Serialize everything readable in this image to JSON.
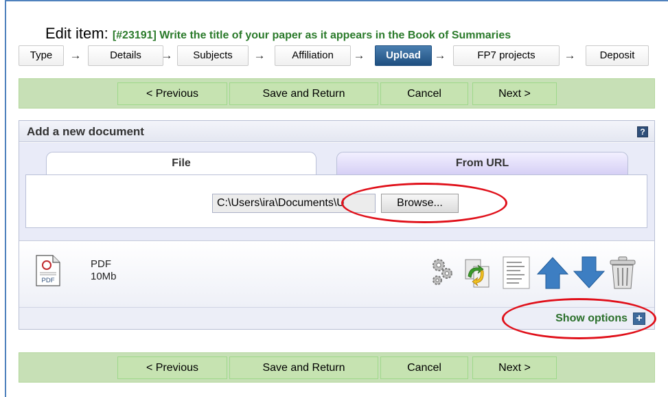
{
  "title": {
    "prefix": "Edit item: ",
    "main": "[#23191] Write the title of your paper as it appears in the Book of Summaries"
  },
  "steps": [
    "Type",
    "Details",
    "Subjects",
    "Affiliation",
    "Upload",
    "FP7 projects",
    "Deposit"
  ],
  "active_step": "Upload",
  "step_arrow": "→",
  "nav": {
    "previous": "< Previous",
    "save_return": "Save and Return",
    "cancel": "Cancel",
    "next": "Next >"
  },
  "panel": {
    "title": "Add a new document",
    "help": "?",
    "tabs": {
      "file": "File",
      "url": "From URL"
    },
    "file_value": "C:\\Users\\ira\\Documents\\U",
    "browse": "Browse..."
  },
  "document": {
    "type": "PDF",
    "size": "10Mb",
    "icon_label": "PDF"
  },
  "options": {
    "show_options": "Show options",
    "plus": "+"
  },
  "colors": {
    "accent_green": "#2a7a2a",
    "active_step": "#1f4f80",
    "nav_bar": "#c7e0b6",
    "highlight_red": "#e0101a"
  }
}
